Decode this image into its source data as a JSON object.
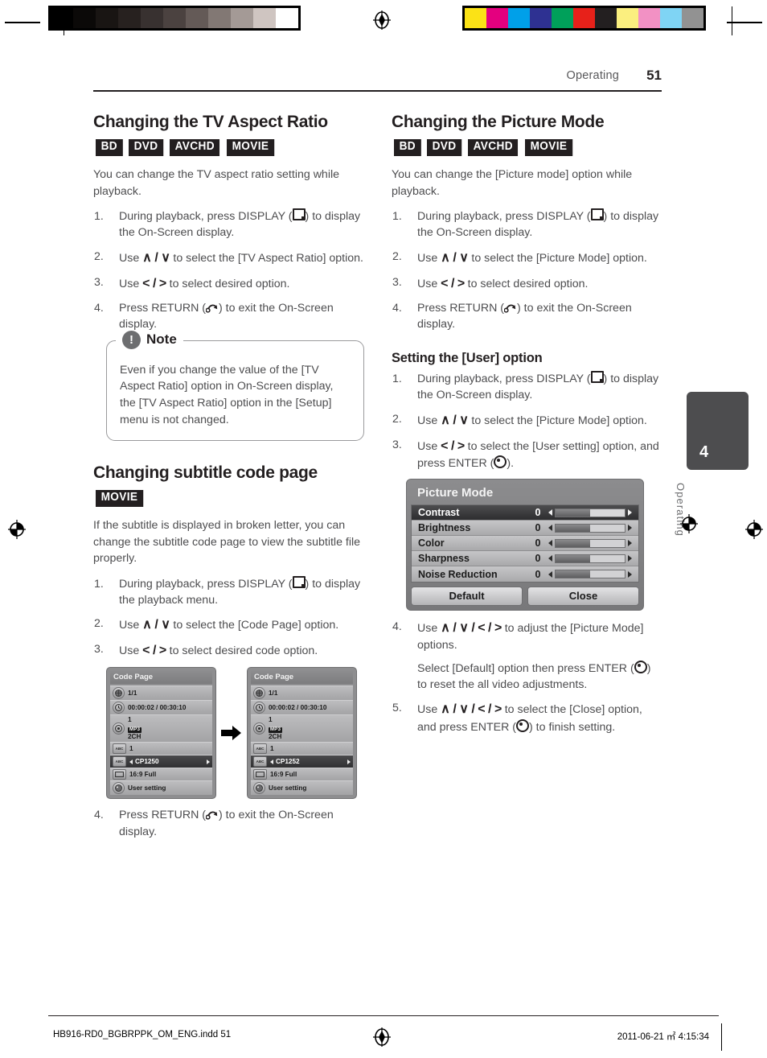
{
  "header": {
    "section": "Operating",
    "page_number": "51"
  },
  "footer": {
    "file": "HB916-RD0_BGBRPPK_OM_ENG.indd   51",
    "timestamp": "2011-06-21   ㎡ 4:15:34"
  },
  "chapter_tab": {
    "number": "4",
    "label": "Operating"
  },
  "calibration": {
    "gray_bars": [
      "#000000",
      "#0b0908",
      "#191513",
      "#27211f",
      "#383130",
      "#4b4240",
      "#645a57",
      "#827874",
      "#a49a96",
      "#cfc5c1",
      "#ffffff"
    ],
    "color_bars": [
      "#fbe216",
      "#e4007f",
      "#00a0e9",
      "#2e3192",
      "#00a05a",
      "#e7211a",
      "#231f20",
      "#fbef7f",
      "#f291c4",
      "#7fd4f4",
      "#929292"
    ]
  },
  "left_column": {
    "section1": {
      "title": "Changing the TV Aspect Ratio",
      "badges": [
        "BD",
        "DVD",
        "AVCHD",
        "MOVIE"
      ],
      "intro": "You can change the TV aspect ratio setting while playback.",
      "steps": [
        {
          "n": "1.",
          "parts": [
            "During playback, press DISPLAY (",
            "DISPLAY-GLYPH",
            ") to display the On-Screen display."
          ]
        },
        {
          "n": "2.",
          "parts": [
            "Use ",
            "UP-DOWN-KEYS",
            " to select the [TV Aspect Ratio] option."
          ]
        },
        {
          "n": "3.",
          "parts": [
            "Use ",
            "LEFT-RIGHT-KEYS",
            " to select desired option."
          ]
        },
        {
          "n": "4.",
          "parts": [
            "Press RETURN (",
            "RETURN-GLYPH",
            ") to exit the On-Screen display."
          ]
        }
      ],
      "note": {
        "label": "Note",
        "icon": "!",
        "text": "Even if you change the value of the [TV Aspect Ratio] option in On-Screen display, the [TV Aspect Ratio] option in the [Setup] menu is not changed."
      }
    },
    "section2": {
      "title": "Changing subtitle code page",
      "badges": [
        "MOVIE"
      ],
      "intro": "If the subtitle is displayed in broken letter, you can change the subtitle code page to view the subtitle file properly.",
      "steps": [
        {
          "n": "1.",
          "parts": [
            "During playback, press DISPLAY (",
            "DISPLAY-GLYPH",
            ") to display the playback menu."
          ]
        },
        {
          "n": "2.",
          "parts": [
            "Use ",
            "UP-DOWN-KEYS",
            " to select the [Code Page] option."
          ]
        },
        {
          "n": "3.",
          "parts": [
            "Use ",
            "LEFT-RIGHT-KEYS",
            " to select desired code option."
          ]
        }
      ],
      "final_step": {
        "n": "4.",
        "parts": [
          "Press RETURN (",
          "RETURN-GLYPH",
          ") to exit the On-Screen display."
        ]
      },
      "osd_before": {
        "title": "Code Page",
        "rows": [
          {
            "icon": "title-icon",
            "value": "1/1",
            "selected": false
          },
          {
            "icon": "clock-icon",
            "value": "00:00:02 / 00:30:10",
            "selected": false
          },
          {
            "icon": "audio-disc-icon",
            "value": "1",
            "badge": "MP3",
            "value2": "2CH",
            "selected": false
          },
          {
            "icon": "subtitle-abc-icon",
            "value": "1",
            "selected": false
          },
          {
            "icon": "code-page-icon",
            "value": "CP1250",
            "selected": true
          },
          {
            "icon": "tv-aspect-icon",
            "value": "16:9 Full",
            "selected": false
          },
          {
            "icon": "picture-mode-icon",
            "value": "User setting",
            "selected": false
          }
        ]
      },
      "osd_after": {
        "title": "Code Page",
        "rows": [
          {
            "icon": "title-icon",
            "value": "1/1",
            "selected": false
          },
          {
            "icon": "clock-icon",
            "value": "00:00:02 / 00:30:10",
            "selected": false
          },
          {
            "icon": "audio-disc-icon",
            "value": "1",
            "badge": "MP3",
            "value2": "2CH",
            "selected": false
          },
          {
            "icon": "subtitle-abc-icon",
            "value": "1",
            "selected": false
          },
          {
            "icon": "code-page-icon",
            "value": "CP1252",
            "selected": true
          },
          {
            "icon": "tv-aspect-icon",
            "value": "16:9 Full",
            "selected": false
          },
          {
            "icon": "picture-mode-icon",
            "value": "User setting",
            "selected": false
          }
        ]
      }
    }
  },
  "right_column": {
    "section1": {
      "title": "Changing the Picture Mode",
      "badges": [
        "BD",
        "DVD",
        "AVCHD",
        "MOVIE"
      ],
      "intro": "You can change the [Picture mode] option while playback.",
      "steps": [
        {
          "n": "1.",
          "parts": [
            "During playback, press DISPLAY (",
            "DISPLAY-GLYPH",
            ") to display the On-Screen display."
          ]
        },
        {
          "n": "2.",
          "parts": [
            "Use ",
            "UP-DOWN-KEYS",
            " to select the [Picture Mode] option."
          ]
        },
        {
          "n": "3.",
          "parts": [
            "Use ",
            "LEFT-RIGHT-KEYS",
            " to select desired option."
          ]
        },
        {
          "n": "4.",
          "parts": [
            "Press RETURN (",
            "RETURN-GLYPH",
            ") to exit the On-Screen display."
          ]
        }
      ]
    },
    "section2": {
      "title": "Setting the [User] option",
      "steps": [
        {
          "n": "1.",
          "parts": [
            "During playback, press DISPLAY (",
            "DISPLAY-GLYPH",
            ") to display the On-Screen display."
          ]
        },
        {
          "n": "2.",
          "parts": [
            "Use ",
            "UP-DOWN-KEYS",
            " to select the [Picture Mode] option."
          ]
        },
        {
          "n": "3.",
          "parts": [
            "Use ",
            "LEFT-RIGHT-KEYS",
            " to select the [User setting] option, and press ENTER (",
            "ENTER-GLYPH",
            ")."
          ]
        }
      ],
      "picture_mode_osd": {
        "title": "Picture Mode",
        "rows": [
          {
            "label": "Contrast",
            "value": "0",
            "selected": true
          },
          {
            "label": "Brightness",
            "value": "0",
            "selected": false
          },
          {
            "label": "Color",
            "value": "0",
            "selected": false
          },
          {
            "label": "Sharpness",
            "value": "0",
            "selected": false
          },
          {
            "label": "Noise Reduction",
            "value": "0",
            "selected": false
          }
        ],
        "buttons": [
          "Default",
          "Close"
        ]
      },
      "steps_after": [
        {
          "n": "4.",
          "parts": [
            "Use ",
            "ALL-ARROW-KEYS",
            " to adjust the [Picture Mode] options."
          ],
          "cont": [
            "Select [Default] option then press ENTER (",
            "ENTER-GLYPH",
            ") to reset the all video adjustments."
          ]
        },
        {
          "n": "5.",
          "parts": [
            "Use ",
            "ALL-ARROW-KEYS",
            " to select the [Close] option, and press ENTER (",
            "ENTER-GLYPH",
            ") to finish setting."
          ]
        }
      ]
    }
  },
  "glyph_text": {
    "up_down": "∧ / ∨",
    "left_right": "< / >",
    "all_arrows": "∧ / ∨ / < / >"
  }
}
